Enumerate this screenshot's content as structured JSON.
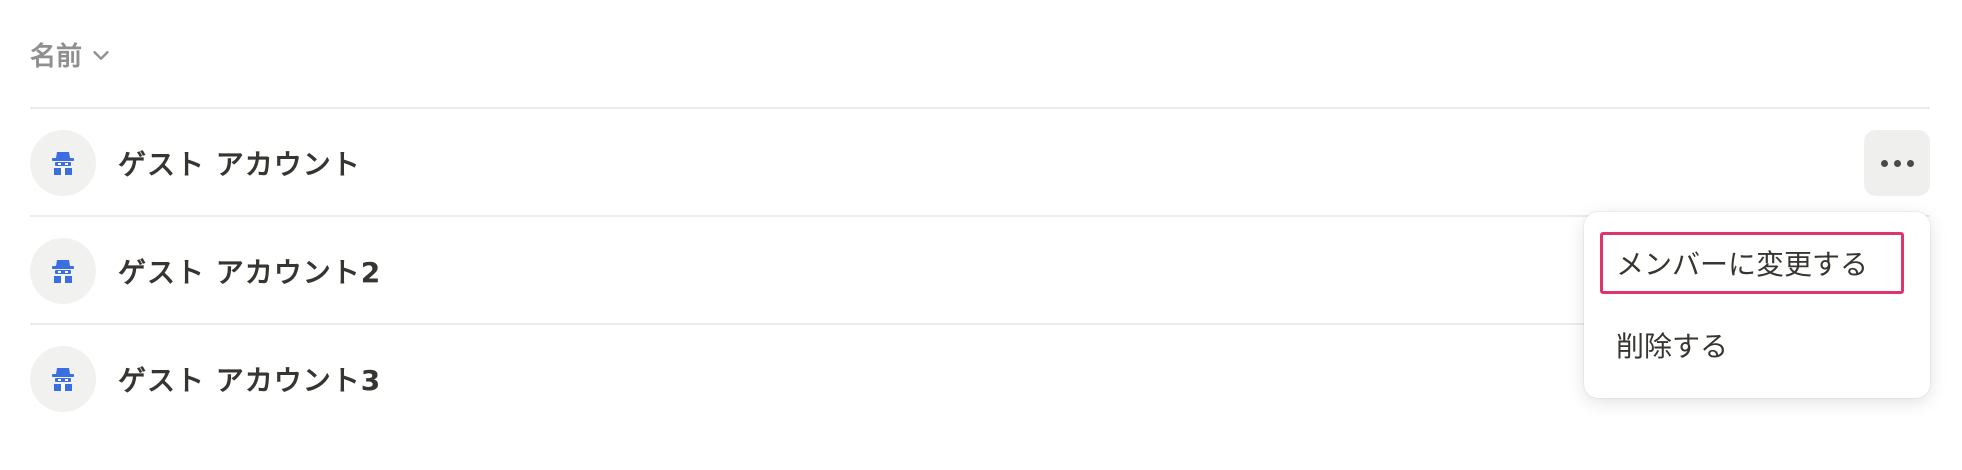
{
  "table": {
    "column_header": "名前",
    "rows": [
      {
        "name": "ゲスト アカウント",
        "avatar_icon": "guest-spy-icon"
      },
      {
        "name": "ゲスト アカウント2",
        "avatar_icon": "guest-spy-icon"
      },
      {
        "name": "ゲスト アカウント3",
        "avatar_icon": "guest-spy-icon"
      }
    ]
  },
  "row_actions": {
    "icon": "more-horizontal-icon"
  },
  "context_menu": {
    "items": [
      {
        "label": "メンバーに変更する",
        "highlighted": true
      },
      {
        "label": "削除する",
        "highlighted": false
      }
    ],
    "highlight_color": "#e0356a"
  },
  "colors": {
    "avatar_icon": "#3b6ee0",
    "header_text": "#8f8f8f",
    "text": "#37352f"
  }
}
